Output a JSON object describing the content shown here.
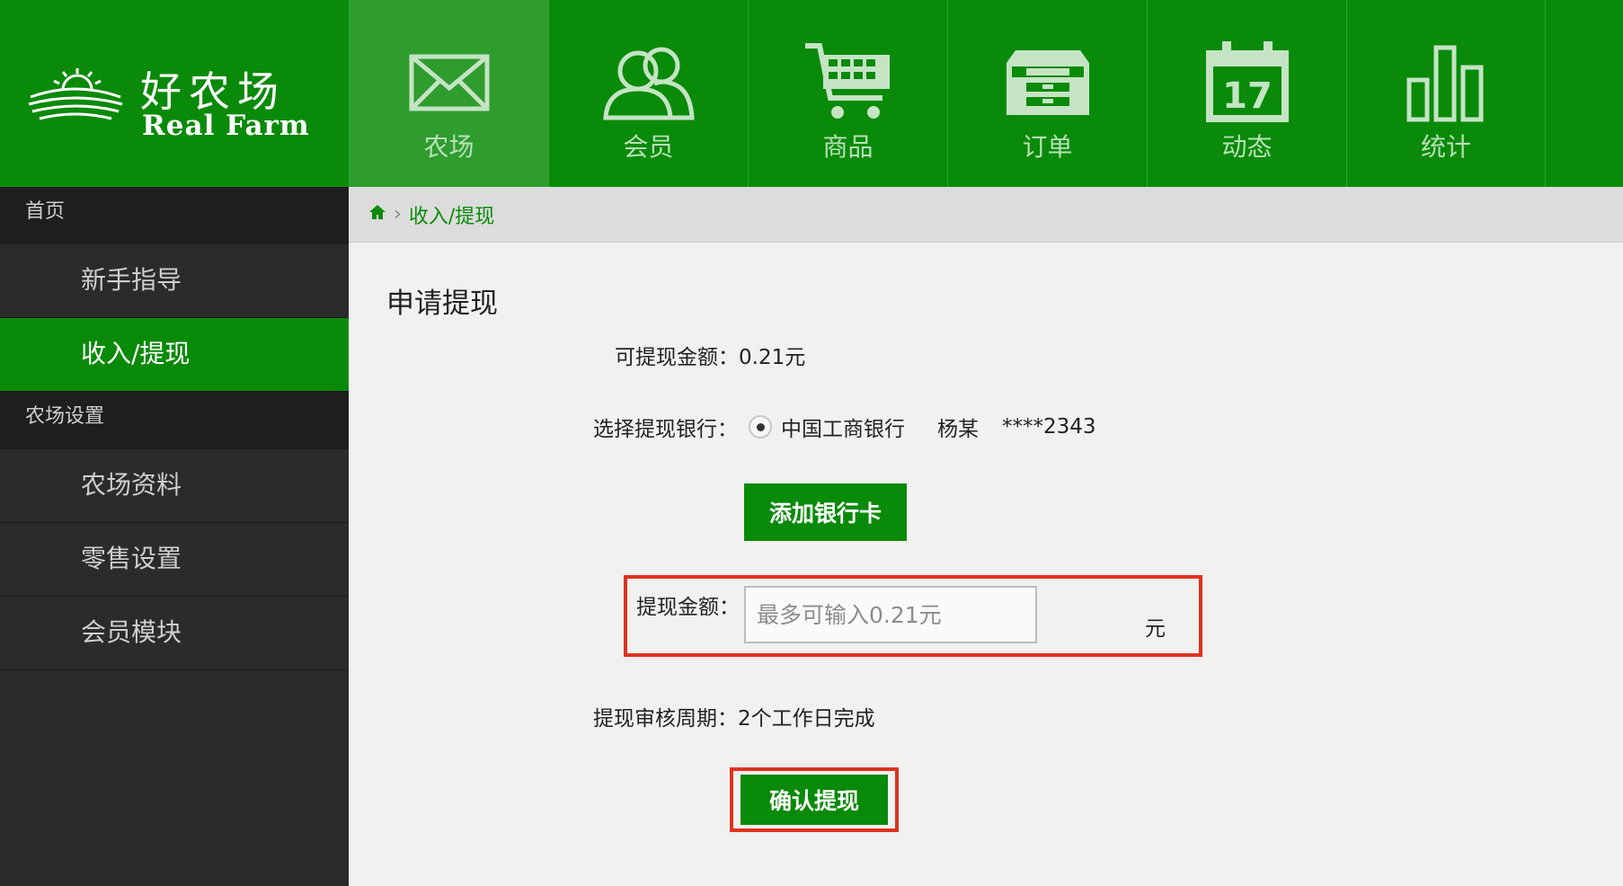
{
  "logo": {
    "cn": "好农场",
    "en": "Real Farm"
  },
  "nav": [
    {
      "label": "农场",
      "icon": "envelope-icon",
      "active": true
    },
    {
      "label": "会员",
      "icon": "members-icon"
    },
    {
      "label": "商品",
      "icon": "cart-icon"
    },
    {
      "label": "订单",
      "icon": "cabinet-icon"
    },
    {
      "label": "动态",
      "icon": "calendar-icon",
      "calendar_day": "17"
    },
    {
      "label": "统计",
      "icon": "bar-chart-icon"
    }
  ],
  "sidebar": {
    "groups": [
      {
        "title": "首页",
        "items": [
          {
            "label": "新手指导"
          },
          {
            "label": "收入/提现",
            "active": true
          }
        ]
      },
      {
        "title": "农场设置",
        "items": [
          {
            "label": "农场资料"
          },
          {
            "label": "零售设置"
          },
          {
            "label": "会员模块"
          }
        ]
      }
    ]
  },
  "breadcrumb": {
    "current": "收入/提现"
  },
  "form": {
    "title": "申请提现",
    "available_label": "可提现金额：",
    "available_value": "0.21元",
    "bank_label": "选择提现银行：",
    "bank_name": "中国工商银行",
    "bank_holder": "杨某",
    "bank_card": "****2343",
    "add_card_label": "添加银行卡",
    "amount_label": "提现金额：",
    "amount_placeholder": "最多可输入0.21元",
    "amount_unit": "元",
    "period_label": "提现审核周期：",
    "period_value": "2个工作日完成",
    "confirm_label": "确认提现"
  },
  "colors": {
    "brand_green": "#0a8a09",
    "highlight_red": "#e0321e",
    "sidebar_dark": "#2b2b2b"
  }
}
